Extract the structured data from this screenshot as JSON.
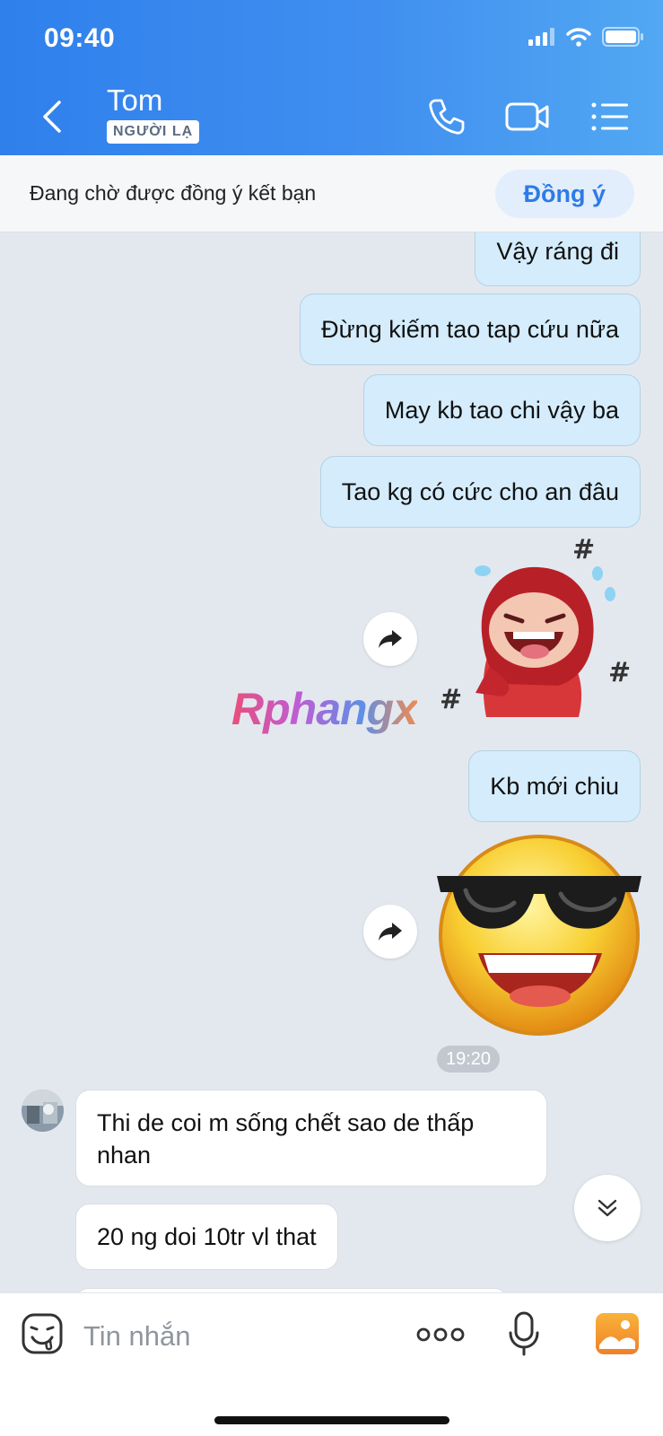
{
  "status_bar": {
    "time": "09:40"
  },
  "header": {
    "contact_name": "Tom",
    "badge": "NGƯỜI LẠ"
  },
  "friend_request": {
    "text": "Đang chờ được đồng ý kết bạn",
    "accept_label": "Đồng ý"
  },
  "messages": {
    "m1": "Vậy ráng đi",
    "m2": "Đừng kiếm tao tap cứu nữa",
    "m3": "May kb tao chi vậy ba",
    "m4": "Tao kg có cức cho an đâu",
    "m5": "Kb mới chiu",
    "timestamp": "19:20",
    "m6_line1": "Thi de coi m sống chết sao de thấp",
    "m6_line2": "nhan",
    "m7": "20 ng doi 10tr vl that"
  },
  "watermark": "Rphangx",
  "input": {
    "placeholder": "Tin nhắn"
  },
  "colors": {
    "header_start": "#2f80ec",
    "header_end": "#52a8f2",
    "outgoing_bubble": "#d4ecfb",
    "accent": "#2d7be6"
  }
}
